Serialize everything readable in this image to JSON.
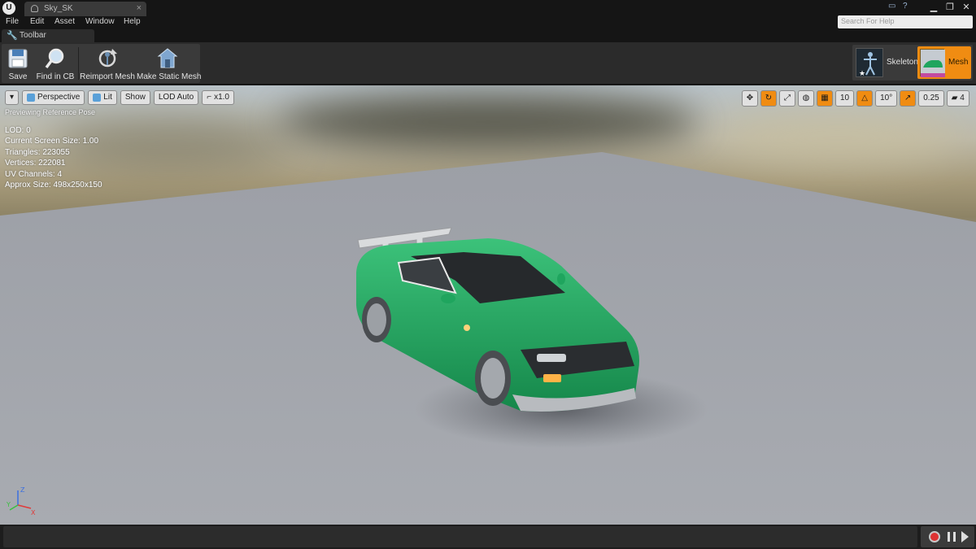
{
  "window": {
    "tab_title": "Sky_SK",
    "tab_close": "×",
    "logo": "U",
    "buttons": [
      "▁",
      "❐",
      "✕"
    ]
  },
  "menu": {
    "items": [
      "File",
      "Edit",
      "Asset",
      "Window",
      "Help"
    ],
    "help_search_placeholder": "Search For Help"
  },
  "toolbar": {
    "tab_label": "Toolbar",
    "buttons": [
      {
        "label": "Save",
        "icon": "save-icon"
      },
      {
        "label": "Find in CB",
        "icon": "find-magnifier-icon"
      },
      {
        "label": "Reimport Mesh",
        "icon": "reimport-icon"
      },
      {
        "label": "Make Static Mesh",
        "icon": "static-mesh-icon"
      }
    ],
    "modes": [
      {
        "label": "Skeleton",
        "active": false
      },
      {
        "label": "Mesh",
        "active": true
      }
    ]
  },
  "viewport": {
    "left_controls": {
      "menu_arrow": "▾",
      "perspective": "Perspective",
      "lit": "Lit",
      "show": "Show",
      "lod": "LOD Auto",
      "speed": "x1.0"
    },
    "right_controls": {
      "grid_snap": "10",
      "rotation_snap": "10°",
      "scale_snap": "0.25",
      "camera_speed": "4"
    },
    "preview_note": "Previewing Reference Pose",
    "stats": [
      "LOD: 0",
      "Current Screen Size: 1.00",
      "Triangles: 223055",
      "Vertices: 222081",
      "UV Channels: 4",
      "Approx Size: 498x250x150"
    ],
    "axis_labels": {
      "z": "Z",
      "y": "Y",
      "x": "X"
    }
  },
  "colors": {
    "accent": "#f08c12",
    "car_body": "#1fa55e",
    "floor": "#a4a7ad"
  }
}
